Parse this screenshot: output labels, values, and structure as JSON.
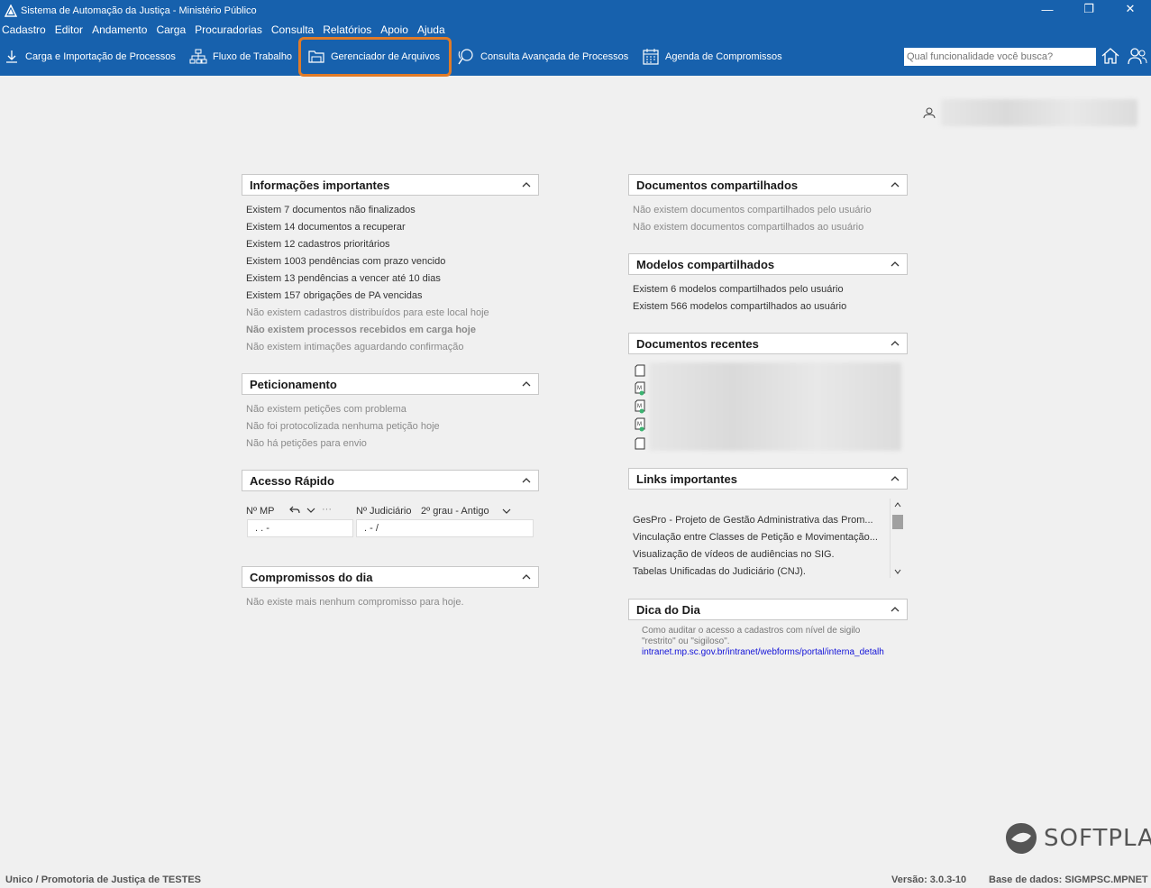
{
  "window": {
    "title": "Sistema de Automação da Justiça - Ministério Público",
    "controls": [
      "—",
      "❐",
      "✕"
    ]
  },
  "menu": [
    "Cadastro",
    "Editor",
    "Andamento",
    "Carga",
    "Procuradorias",
    "Consulta",
    "Relatórios",
    "Apoio",
    "Ajuda"
  ],
  "toolbar": {
    "carga": "Carga e Importação de Processos",
    "fluxo": "Fluxo de Trabalho",
    "gerenciador": "Gerenciador de Arquivos",
    "consulta": "Consulta Avançada de Processos",
    "agenda": "Agenda de Compromissos",
    "search_placeholder": "Qual funcionalidade você busca?",
    "highlight_color": "#e07b28"
  },
  "panels": {
    "info": {
      "title": "Informações importantes",
      "lines": [
        "Existem 7 documentos não finalizados",
        "Existem 14 documentos a recuperar",
        "Existem 12 cadastros prioritários",
        "Existem 1003 pendências com prazo vencido",
        "Existem 13 pendências a vencer até 10 dias",
        "Existem 157 obrigações de PA vencidas",
        "Não existem cadastros distribuídos para este local hoje",
        "Não existem processos recebidos em carga hoje",
        "Não existem intimações aguardando confirmação"
      ]
    },
    "peticionamento": {
      "title": "Peticionamento",
      "lines": [
        "Não existem petições com problema",
        "Não foi protocolizada nenhuma petição hoje",
        "Não há petições para envio"
      ]
    },
    "acesso": {
      "title": "Acesso Rápido",
      "nmp_label": "Nº MP",
      "more": "···",
      "nj_label": "Nº Judiciário",
      "grau": "2º grau - Antigo",
      "nmp_value": ".   .       -",
      "nj_value": ".     - /"
    },
    "compromissos": {
      "title": "Compromissos do dia",
      "lines": [
        "Não existe mais nenhum compromisso para hoje."
      ]
    },
    "doc_compart": {
      "title": "Documentos compartilhados",
      "lines": [
        "Não existem documentos compartilhados pelo usuário",
        "Não existem documentos compartilhados ao usuário"
      ]
    },
    "modelos": {
      "title": "Modelos compartilhados",
      "lines": [
        "Existem 6 modelos compartilhados pelo usuário",
        "Existem 566 modelos compartilhados ao usuário"
      ]
    },
    "recentes": {
      "title": "Documentos recentes"
    },
    "links": {
      "title": "Links importantes",
      "lines": [
        "GesPro - Projeto de Gestão Administrativa das Prom...",
        "Vinculação entre Classes de Petição e Movimentação...",
        "Visualização de vídeos de audiências no SIG.",
        "Tabelas Unificadas do Judiciário (CNJ)."
      ]
    },
    "dica": {
      "title": "Dica do Dia",
      "text1": "Como auditar o acesso a cadastros com nível de sigilo",
      "text2": "\"restrito\" ou \"sigiloso\".",
      "link": "intranet.mp.sc.gov.br/intranet/webforms/portal/interna_detalh"
    }
  },
  "footer": {
    "location": "Unico / Promotoria de Justiça de TESTES",
    "version": "Versão: 3.0.3-10",
    "database": "Base de dados: SIGMPSC.MPNET",
    "brand": "SOFTPLAN"
  }
}
